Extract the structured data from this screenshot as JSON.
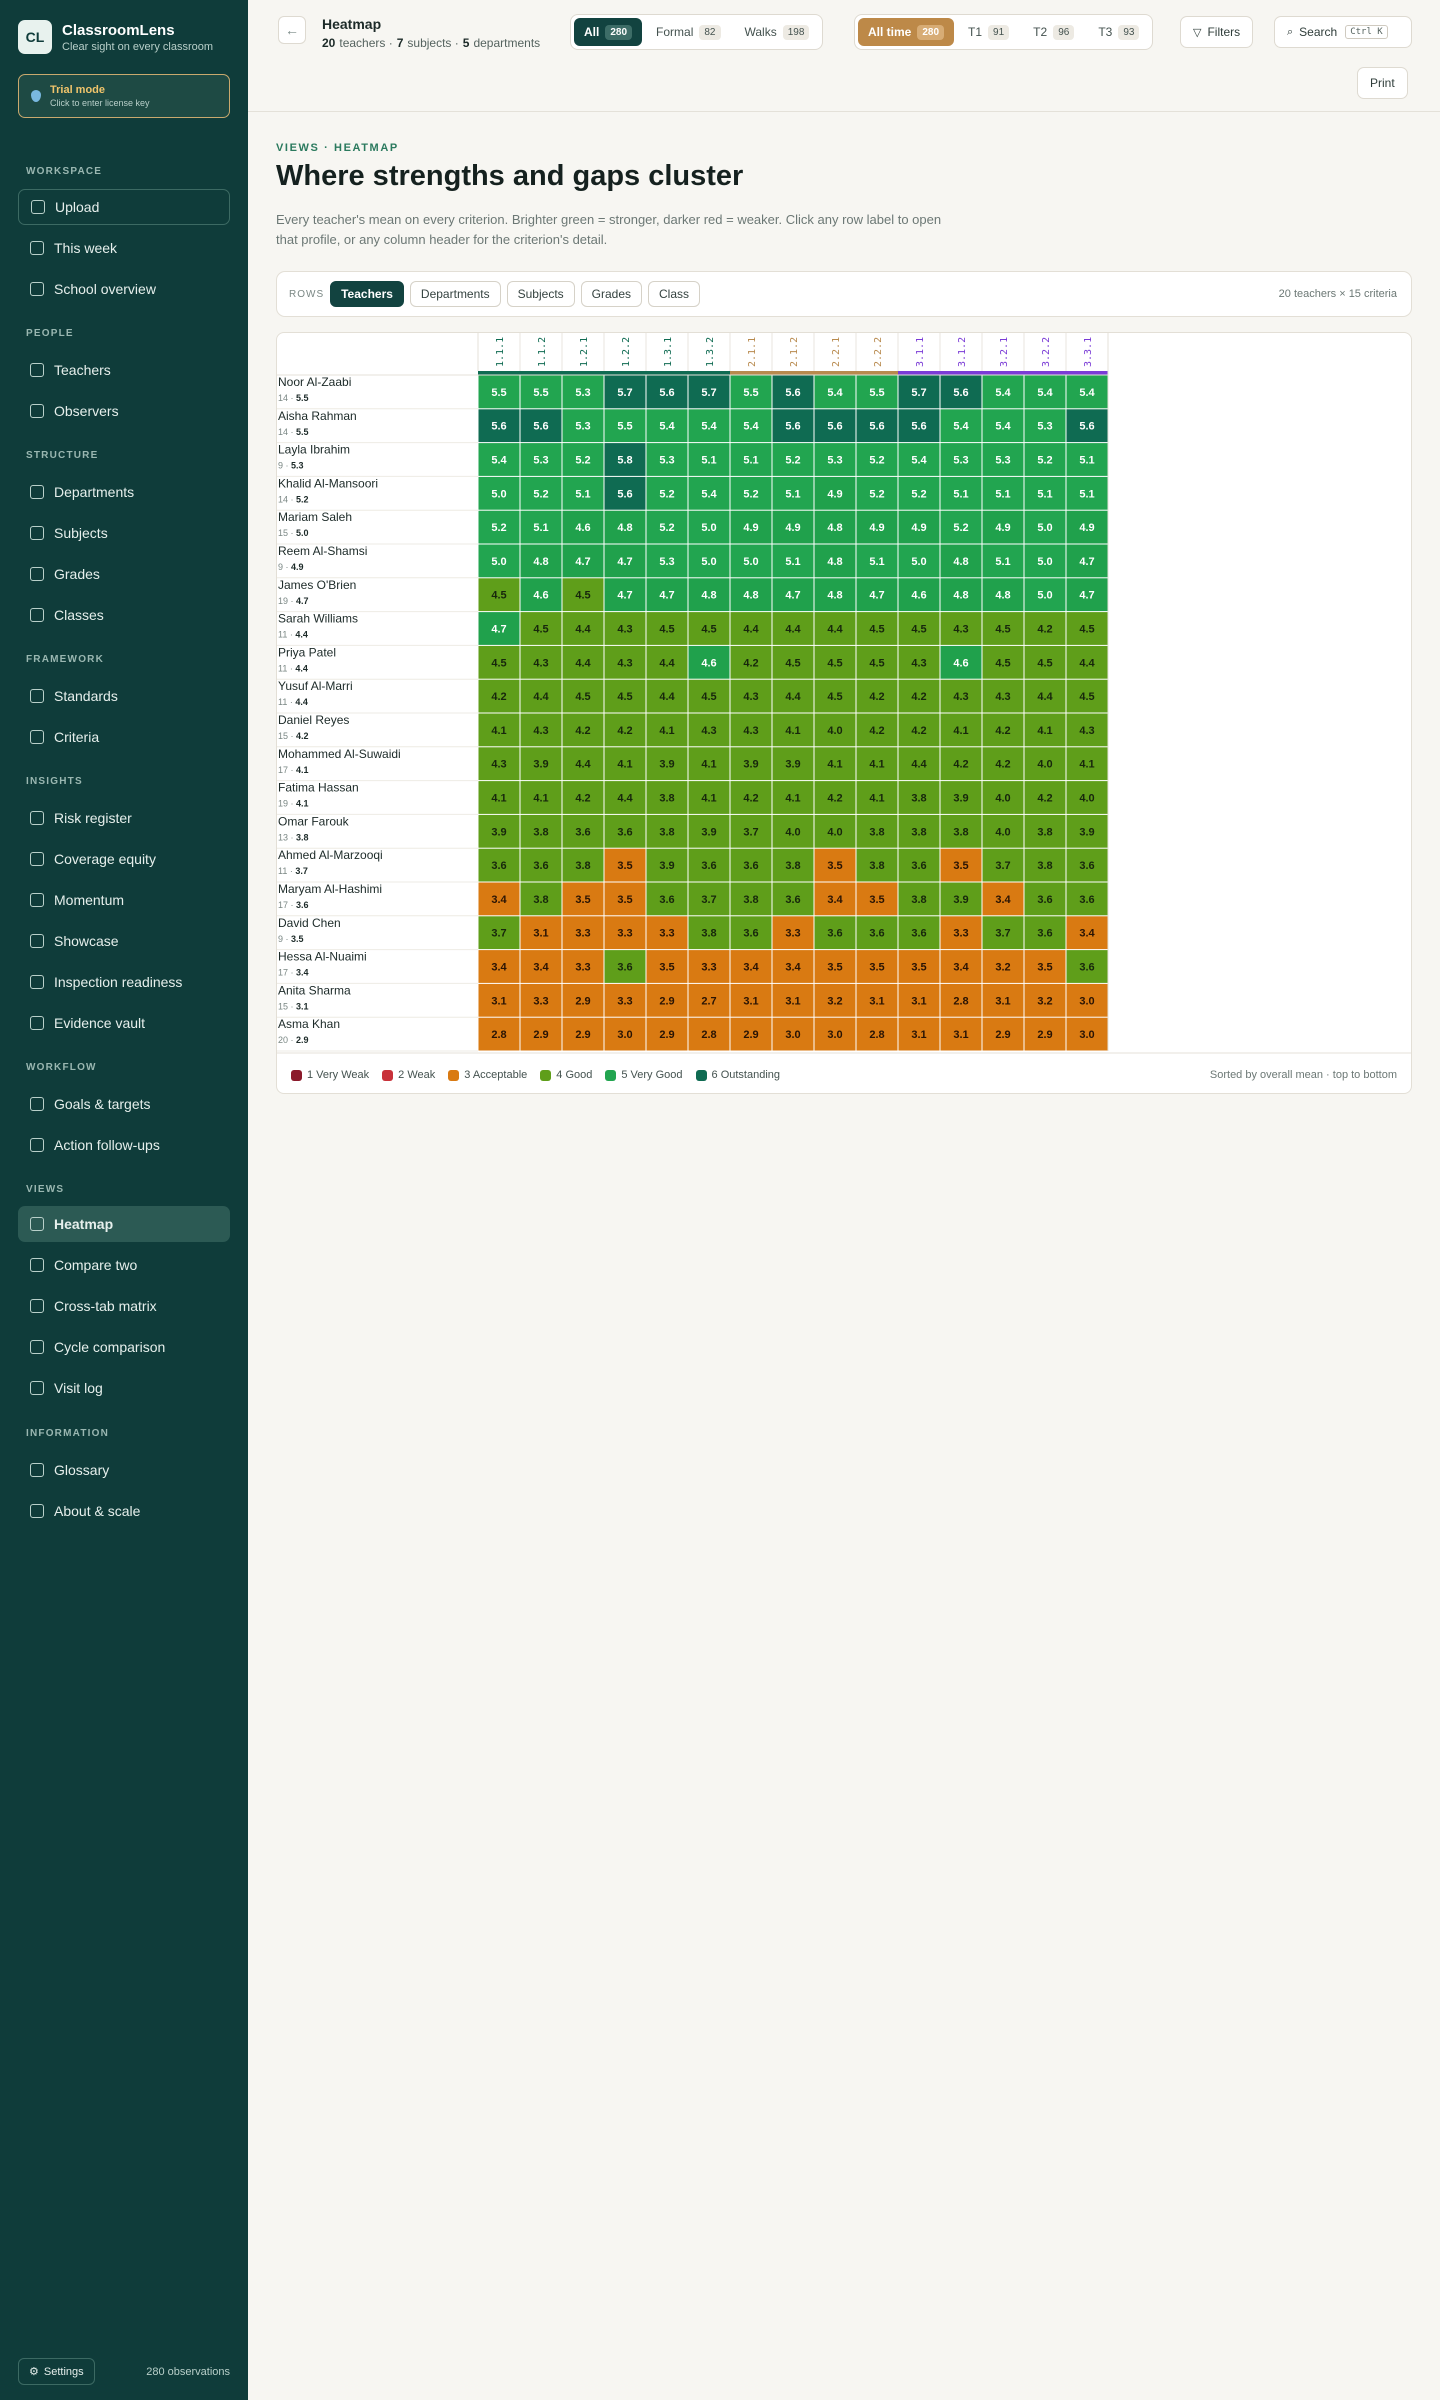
{
  "brand": {
    "logo": "CL",
    "name": "ClassroomLens",
    "tagline": "Clear sight on every classroom"
  },
  "trial": {
    "title": "Trial mode",
    "subtitle": "Click to enter license key"
  },
  "nav": {
    "headings": {
      "workspace": "WORKSPACE",
      "people": "PEOPLE",
      "structure": "STRUCTURE",
      "framework": "FRAMEWORK",
      "insights": "INSIGHTS",
      "workflow": "WORKFLOW",
      "views": "VIEWS",
      "information": "INFORMATION"
    },
    "items": {
      "upload": "Upload",
      "this_week": "This week",
      "school_overview": "School overview",
      "teachers": "Teachers",
      "observers": "Observers",
      "departments": "Departments",
      "subjects": "Subjects",
      "grades": "Grades",
      "classes": "Classes",
      "standards": "Standards",
      "criteria": "Criteria",
      "risk_register": "Risk register",
      "coverage_equity": "Coverage equity",
      "momentum": "Momentum",
      "showcase": "Showcase",
      "inspection_readiness": "Inspection readiness",
      "evidence_vault": "Evidence vault",
      "goals_targets": "Goals & targets",
      "action_followups": "Action follow-ups",
      "heatmap": "Heatmap",
      "compare_two": "Compare two",
      "crosstab": "Cross-tab matrix",
      "cycle_comparison": "Cycle comparison",
      "visit_log": "Visit log",
      "glossary": "Glossary",
      "about_scale": "About & scale"
    }
  },
  "footer": {
    "settings": "Settings",
    "observations": "280 observations"
  },
  "header": {
    "title": "Heatmap",
    "teachers_count": "20",
    "teachers_label": "teachers ·",
    "subjects_count": "7",
    "subjects_label": "subjects ·",
    "departments_count": "5",
    "departments_label": "departments"
  },
  "type_filter": {
    "all": "All",
    "all_count": "280",
    "formal": "Formal",
    "formal_count": "82",
    "walks": "Walks",
    "walks_count": "198"
  },
  "time_filter": {
    "all_time": "All time",
    "all_time_count": "280",
    "t1": "T1",
    "t1_count": "91",
    "t2": "T2",
    "t2_count": "96",
    "t3": "T3",
    "t3_count": "93"
  },
  "toolbar": {
    "filters": "Filters",
    "search": "Search",
    "search_kbd": "Ctrl K",
    "print": "Print"
  },
  "main": {
    "eyebrow": "VIEWS · HEATMAP",
    "title": "Where strengths and gaps cluster",
    "lead": "Every teacher's mean on every criterion. Brighter green = stronger, darker red = weaker. Click any row label to open that profile, or any column header for the criterion's detail."
  },
  "rows_selector": {
    "label": "ROWS",
    "options": [
      "Teachers",
      "Departments",
      "Subjects",
      "Grades",
      "Class"
    ],
    "selected": "Teachers",
    "summary": "20 teachers × 15 criteria"
  },
  "heatmap": {
    "criteria": [
      "1.1.1",
      "1.1.2",
      "1.2.1",
      "1.2.2",
      "1.3.1",
      "1.3.2",
      "2.1.1",
      "2.1.2",
      "2.2.1",
      "2.2.2",
      "3.1.1",
      "3.1.2",
      "3.2.1",
      "3.2.2",
      "3.3.1"
    ],
    "standard_colors": {
      "1": "#0f6b52",
      "2": "#b88a4e",
      "3": "#7a3bd6"
    },
    "teachers": [
      {
        "name": "Noor Al-Zaabi",
        "obs": "14",
        "mean": "5.5",
        "values": [
          5.5,
          5.5,
          5.3,
          5.7,
          5.6,
          5.7,
          5.5,
          5.6,
          5.4,
          5.5,
          5.7,
          5.6,
          5.4,
          5.4,
          5.4
        ]
      },
      {
        "name": "Aisha Rahman",
        "obs": "14",
        "mean": "5.5",
        "values": [
          5.6,
          5.6,
          5.3,
          5.5,
          5.4,
          5.4,
          5.4,
          5.6,
          5.6,
          5.6,
          5.6,
          5.4,
          5.4,
          5.3,
          5.6
        ]
      },
      {
        "name": "Layla Ibrahim",
        "obs": "9",
        "mean": "5.3",
        "values": [
          5.4,
          5.3,
          5.2,
          5.8,
          5.3,
          5.1,
          5.1,
          5.2,
          5.3,
          5.2,
          5.4,
          5.3,
          5.3,
          5.2,
          5.1
        ]
      },
      {
        "name": "Khalid Al-Mansoori",
        "obs": "14",
        "mean": "5.2",
        "values": [
          5.0,
          5.2,
          5.1,
          5.6,
          5.2,
          5.4,
          5.2,
          5.1,
          4.9,
          5.2,
          5.2,
          5.1,
          5.1,
          5.1,
          5.1
        ]
      },
      {
        "name": "Mariam Saleh",
        "obs": "15",
        "mean": "5.0",
        "values": [
          5.2,
          5.1,
          4.6,
          4.8,
          5.2,
          5.0,
          4.9,
          4.9,
          4.8,
          4.9,
          4.9,
          5.2,
          4.9,
          5.0,
          4.9
        ]
      },
      {
        "name": "Reem Al-Shamsi",
        "obs": "9",
        "mean": "4.9",
        "values": [
          5.0,
          4.8,
          4.7,
          4.7,
          5.3,
          5.0,
          5.0,
          5.1,
          4.8,
          5.1,
          5.0,
          4.8,
          5.1,
          5.0,
          4.7
        ]
      },
      {
        "name": "James O'Brien",
        "obs": "19",
        "mean": "4.7",
        "values": [
          4.5,
          4.6,
          4.5,
          4.7,
          4.7,
          4.8,
          4.8,
          4.7,
          4.8,
          4.7,
          4.6,
          4.8,
          4.8,
          5.0,
          4.7
        ]
      },
      {
        "name": "Sarah Williams",
        "obs": "11",
        "mean": "4.4",
        "values": [
          4.7,
          4.5,
          4.4,
          4.3,
          4.5,
          4.5,
          4.4,
          4.4,
          4.4,
          4.5,
          4.5,
          4.3,
          4.5,
          4.2,
          4.5
        ]
      },
      {
        "name": "Priya Patel",
        "obs": "11",
        "mean": "4.4",
        "values": [
          4.5,
          4.3,
          4.4,
          4.3,
          4.4,
          4.6,
          4.2,
          4.5,
          4.5,
          4.5,
          4.3,
          4.6,
          4.5,
          4.5,
          4.4
        ]
      },
      {
        "name": "Yusuf Al-Marri",
        "obs": "11",
        "mean": "4.4",
        "values": [
          4.2,
          4.4,
          4.5,
          4.5,
          4.4,
          4.5,
          4.3,
          4.4,
          4.5,
          4.2,
          4.2,
          4.3,
          4.3,
          4.4,
          4.5
        ]
      },
      {
        "name": "Daniel Reyes",
        "obs": "15",
        "mean": "4.2",
        "values": [
          4.1,
          4.3,
          4.2,
          4.2,
          4.1,
          4.3,
          4.3,
          4.1,
          4.0,
          4.2,
          4.2,
          4.1,
          4.2,
          4.1,
          4.3
        ]
      },
      {
        "name": "Mohammed Al-Suwaidi",
        "obs": "17",
        "mean": "4.1",
        "values": [
          4.3,
          3.9,
          4.4,
          4.1,
          3.9,
          4.1,
          3.9,
          3.9,
          4.1,
          4.1,
          4.4,
          4.2,
          4.2,
          4.0,
          4.1
        ]
      },
      {
        "name": "Fatima Hassan",
        "obs": "19",
        "mean": "4.1",
        "values": [
          4.1,
          4.1,
          4.2,
          4.4,
          3.8,
          4.1,
          4.2,
          4.1,
          4.2,
          4.1,
          3.8,
          3.9,
          4.0,
          4.2,
          4.0
        ]
      },
      {
        "name": "Omar Farouk",
        "obs": "13",
        "mean": "3.8",
        "values": [
          3.9,
          3.8,
          3.6,
          3.6,
          3.8,
          3.9,
          3.7,
          4.0,
          4.0,
          3.8,
          3.8,
          3.8,
          4.0,
          3.8,
          3.9
        ]
      },
      {
        "name": "Ahmed Al-Marzooqi",
        "obs": "11",
        "mean": "3.7",
        "values": [
          3.6,
          3.6,
          3.8,
          3.5,
          3.9,
          3.6,
          3.6,
          3.8,
          3.5,
          3.8,
          3.6,
          3.5,
          3.7,
          3.8,
          3.6
        ]
      },
      {
        "name": "Maryam Al-Hashimi",
        "obs": "17",
        "mean": "3.6",
        "values": [
          3.4,
          3.8,
          3.5,
          3.5,
          3.6,
          3.7,
          3.8,
          3.6,
          3.4,
          3.5,
          3.8,
          3.9,
          3.4,
          3.6,
          3.6
        ]
      },
      {
        "name": "David Chen",
        "obs": "9",
        "mean": "3.5",
        "values": [
          3.7,
          3.1,
          3.3,
          3.3,
          3.3,
          3.8,
          3.6,
          3.3,
          3.6,
          3.6,
          3.6,
          3.3,
          3.7,
          3.6,
          3.4
        ]
      },
      {
        "name": "Hessa Al-Nuaimi",
        "obs": "17",
        "mean": "3.4",
        "values": [
          3.4,
          3.4,
          3.3,
          3.6,
          3.5,
          3.3,
          3.4,
          3.4,
          3.5,
          3.5,
          3.5,
          3.4,
          3.2,
          3.5,
          3.6
        ]
      },
      {
        "name": "Anita Sharma",
        "obs": "15",
        "mean": "3.1",
        "values": [
          3.1,
          3.3,
          2.9,
          3.3,
          2.9,
          2.7,
          3.1,
          3.1,
          3.2,
          3.1,
          3.1,
          2.8,
          3.1,
          3.2,
          3.0
        ]
      },
      {
        "name": "Asma Khan",
        "obs": "20",
        "mean": "2.9",
        "values": [
          2.8,
          2.9,
          2.9,
          3.0,
          2.9,
          2.8,
          2.9,
          3.0,
          3.0,
          2.8,
          3.1,
          3.1,
          2.9,
          2.9,
          3.0
        ]
      }
    ]
  },
  "legend": [
    {
      "label": "1 Very Weak",
      "color": "#8b1a2b"
    },
    {
      "label": "2 Weak",
      "color": "#c8323a"
    },
    {
      "label": "3 Acceptable",
      "color": "#d97a12"
    },
    {
      "label": "4 Good",
      "color": "#5f9e1a"
    },
    {
      "label": "5 Very Good",
      "color": "#22a550"
    },
    {
      "label": "6 Outstanding",
      "color": "#0f6b52"
    }
  ],
  "sort_note": "Sorted by overall mean · top to bottom"
}
